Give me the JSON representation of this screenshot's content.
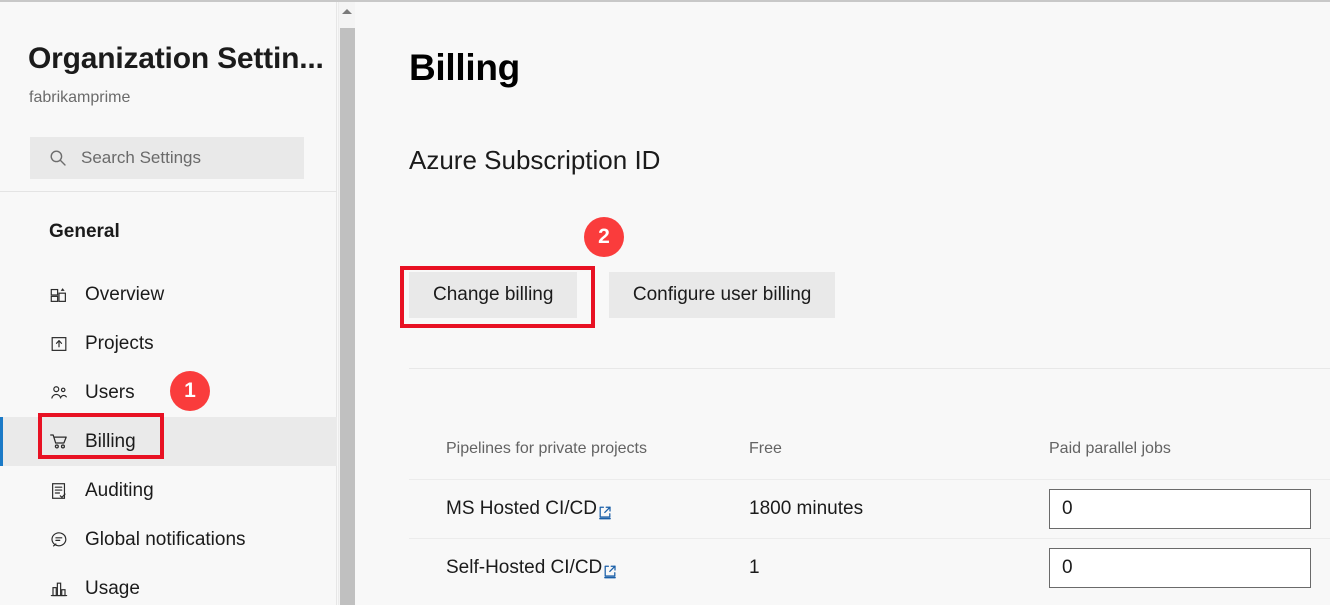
{
  "sidebar": {
    "org_title": "Organization Settin...",
    "org_subtitle": "fabrikamprime",
    "search": {
      "placeholder": "Search Settings",
      "icon": "search-icon"
    },
    "group_title": "General",
    "items": [
      {
        "label": "Overview",
        "icon": "overview-icon",
        "selected": false
      },
      {
        "label": "Projects",
        "icon": "projects-icon",
        "selected": false
      },
      {
        "label": "Users",
        "icon": "users-icon",
        "selected": false
      },
      {
        "label": "Billing",
        "icon": "shopping-cart-icon",
        "selected": true
      },
      {
        "label": "Auditing",
        "icon": "auditing-clipboard-icon",
        "selected": false
      },
      {
        "label": "Global notifications",
        "icon": "chat-bubble-icon",
        "selected": false
      },
      {
        "label": "Usage",
        "icon": "bar-chart-icon",
        "selected": false
      }
    ]
  },
  "main": {
    "page_title": "Billing",
    "section_title": "Azure Subscription ID",
    "buttons": [
      {
        "label": "Change billing"
      },
      {
        "label": "Configure user billing"
      }
    ],
    "table": {
      "headers": [
        "Pipelines for private projects",
        "Free",
        "Paid parallel jobs"
      ],
      "rows": [
        {
          "name": "MS Hosted CI/CD",
          "link_icon": "external-link-icon",
          "free": "1800 minutes",
          "paid": "0"
        },
        {
          "name": "Self-Hosted CI/CD",
          "link_icon": "external-link-icon",
          "free": "1",
          "paid": "0"
        }
      ]
    }
  },
  "annotations": {
    "badges": [
      {
        "label": "1",
        "target": "sidebar-item-billing"
      },
      {
        "label": "2",
        "target": "change-billing-button"
      }
    ],
    "highlight_color": "#e81123",
    "badge_color": "#fa3c3c"
  },
  "scrollbar": {
    "up_arrow": "chevron-up-icon"
  }
}
